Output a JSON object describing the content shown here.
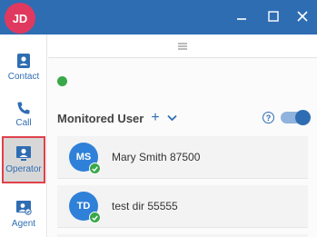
{
  "titlebar": {
    "avatar_initials": "JD",
    "colors": {
      "bar": "#2f6db3",
      "avatar": "#e0395f"
    },
    "controls": [
      "minimize-icon",
      "maximize-icon",
      "close-icon"
    ]
  },
  "sidenav": {
    "items": [
      {
        "label": "Contact",
        "icon": "contact-icon",
        "selected": false
      },
      {
        "label": "Call",
        "icon": "phone-icon",
        "selected": false
      },
      {
        "label": "Operator",
        "icon": "operator-icon",
        "selected": true
      },
      {
        "label": "Agent",
        "icon": "agent-icon",
        "selected": false
      }
    ]
  },
  "main": {
    "splitter_icon": "hamburger-icon",
    "status_color": "#3aa84a",
    "monitored": {
      "title": "Monitored User",
      "add_label": "+",
      "expand_icon": "chevron-down-icon",
      "help_label": "?",
      "toggle_on": true
    },
    "users": [
      {
        "initials": "MS",
        "name": "Mary Smith 87500",
        "status": "available"
      },
      {
        "initials": "TD",
        "name": "test dir 55555",
        "status": "available"
      }
    ]
  }
}
